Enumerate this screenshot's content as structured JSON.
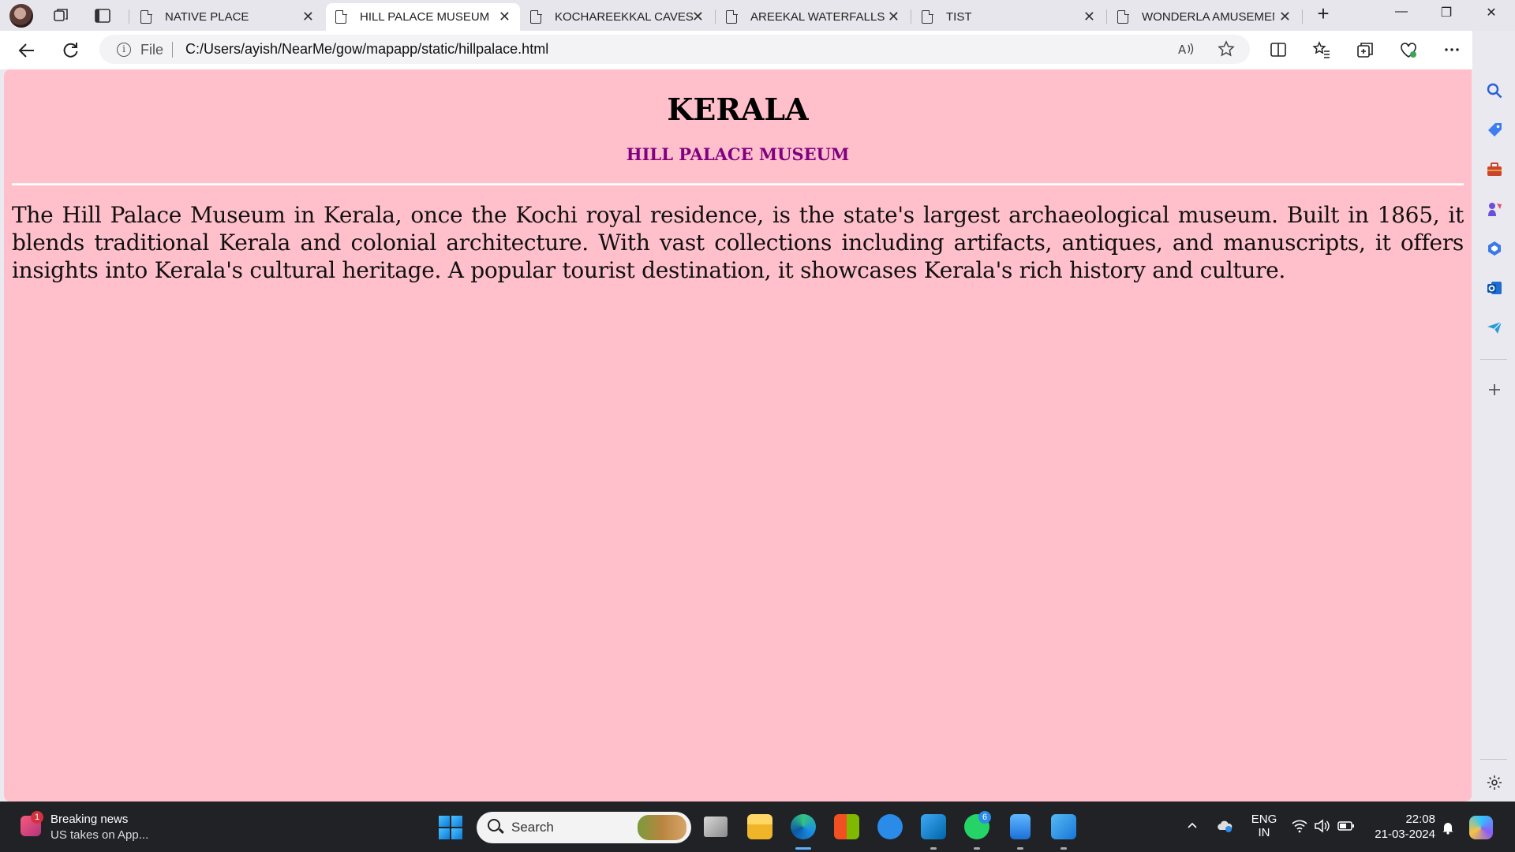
{
  "browser": {
    "tabs": [
      {
        "title": "NATIVE PLACE",
        "active": false
      },
      {
        "title": "HILL PALACE MUSEUM",
        "active": true
      },
      {
        "title": "KOCHAREEKKAL CAVES",
        "active": false
      },
      {
        "title": "AREEKAL WATERFALLS",
        "active": false
      },
      {
        "title": "TIST",
        "active": false
      },
      {
        "title": "WONDERLA AMUSEMEN",
        "active": false
      }
    ],
    "tab_close_glyph": "✕",
    "new_tab_glyph": "+",
    "window_controls": {
      "minimize": "—",
      "restore": "❐",
      "close": "✕"
    },
    "address": {
      "scheme_label": "File",
      "info_glyph": "i",
      "url": "C:/Users/ayish/NearMe/gow/mapapp/static/hillpalace.html"
    }
  },
  "page": {
    "heading": "KERALA",
    "subheading": "HILL PALACE MUSEUM",
    "paragraph": "The Hill Palace Museum in Kerala, once the Kochi royal residence, is the state's largest archaeological museum. Built in 1865, it blends traditional Kerala and colonial architecture. With vast collections including artifacts, antiques, and manuscripts, it offers insights into Kerala's cultural heritage. A popular tourist destination, it showcases Kerala's rich history and culture.",
    "background_color": "#ffc0cb",
    "subheading_color": "#800080"
  },
  "taskbar": {
    "news_badge": "1",
    "news_title": "Breaking news",
    "news_subtitle": "US takes on App...",
    "search_placeholder": "Search",
    "whatsapp_badge": "6",
    "language_line1": "ENG",
    "language_line2": "IN",
    "time": "22:08",
    "date": "21-03-2024"
  },
  "icons": {
    "back": "back-arrow-icon",
    "refresh": "refresh-icon",
    "read_aloud": "read-aloud-icon",
    "favorite": "star-icon",
    "split": "split-screen-icon",
    "favorites": "favorites-icon",
    "collections": "collections-icon",
    "health": "browser-essentials-icon",
    "more": "more-icon",
    "copilot": "copilot-icon"
  }
}
